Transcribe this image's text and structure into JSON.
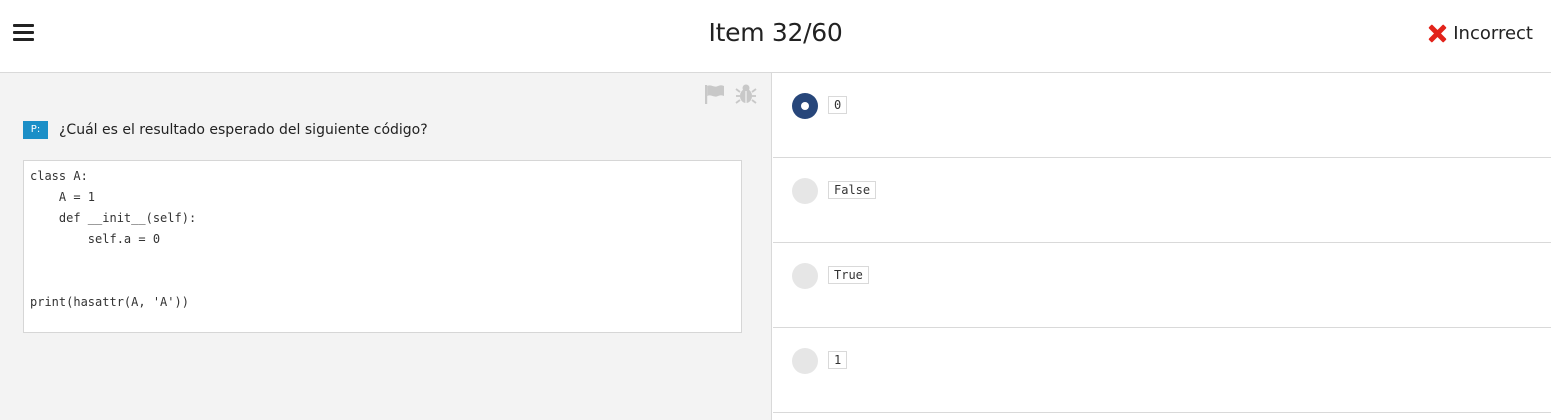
{
  "header": {
    "title": "Item 32/60",
    "status_label": "Incorrect",
    "status_color": "#e2231a"
  },
  "question": {
    "badge": "P:",
    "text": "¿Cuál es el resultado esperado del siguiente código?",
    "code": "class A:\n    A = 1\n    def __init__(self):\n        self.a = 0\n\n\nprint(hasattr(A, 'A'))"
  },
  "tools": {
    "flag_icon": "flag-icon",
    "bug_icon": "bug-icon"
  },
  "options": [
    {
      "label": "0",
      "selected": true
    },
    {
      "label": "False",
      "selected": false
    },
    {
      "label": "True",
      "selected": false
    },
    {
      "label": "1",
      "selected": false
    }
  ],
  "colors": {
    "accent": "#27467a",
    "badge": "#1b8fc7"
  }
}
